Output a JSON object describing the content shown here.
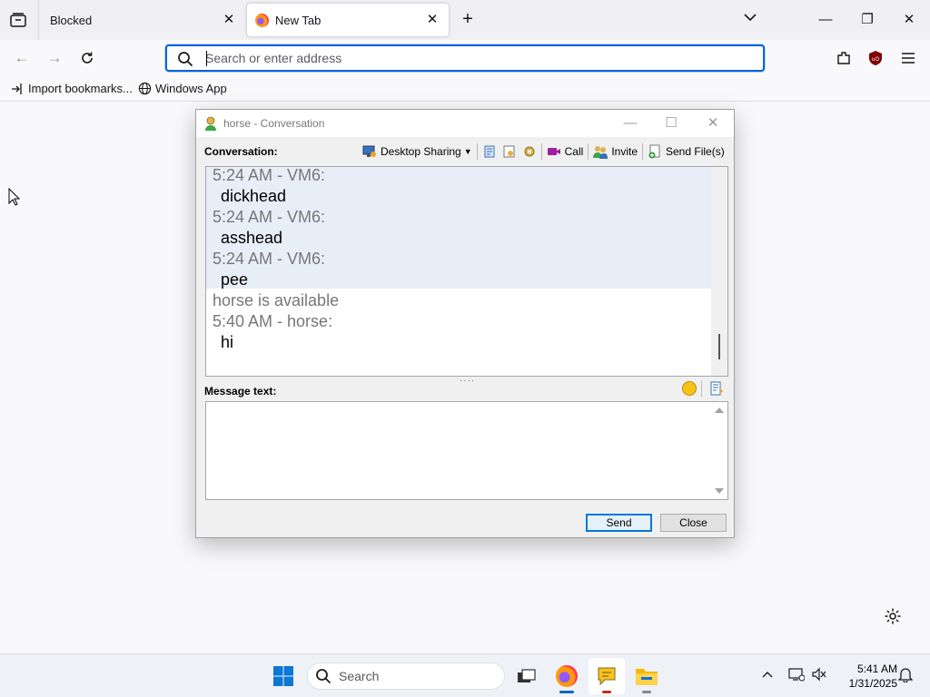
{
  "browser": {
    "tabs": [
      {
        "label": "Blocked"
      },
      {
        "label": "New Tab"
      }
    ],
    "urlbar": {
      "placeholder": "Search or enter address",
      "value": ""
    },
    "bookmarks": [
      {
        "label": "Import bookmarks..."
      },
      {
        "label": "Windows App"
      }
    ]
  },
  "conversation": {
    "title": "horse - Conversation",
    "conversation_label": "Conversation:",
    "toolbar": {
      "desktop_sharing": "Desktop Sharing",
      "call": "Call",
      "invite": "Invite",
      "send_files": "Send File(s)"
    },
    "messages": [
      {
        "meta": "5:24 AM - VM6:",
        "text": "dickhead"
      },
      {
        "meta": "5:24 AM - VM6:",
        "text": "asshead"
      },
      {
        "meta": "5:24 AM - VM6:",
        "text": "pee"
      },
      {
        "meta": "horse is available",
        "text": ""
      },
      {
        "meta": "5:40 AM - horse:",
        "text": "hi"
      }
    ],
    "message_text_label": "Message text:",
    "input_value": "",
    "send_label": "Send",
    "close_label": "Close"
  },
  "taskbar": {
    "search_placeholder": "Search",
    "time": "5:41 AM",
    "date": "1/31/2025"
  },
  "colors": {
    "accent": "#0061e0",
    "highlight": "#e8eef8"
  }
}
